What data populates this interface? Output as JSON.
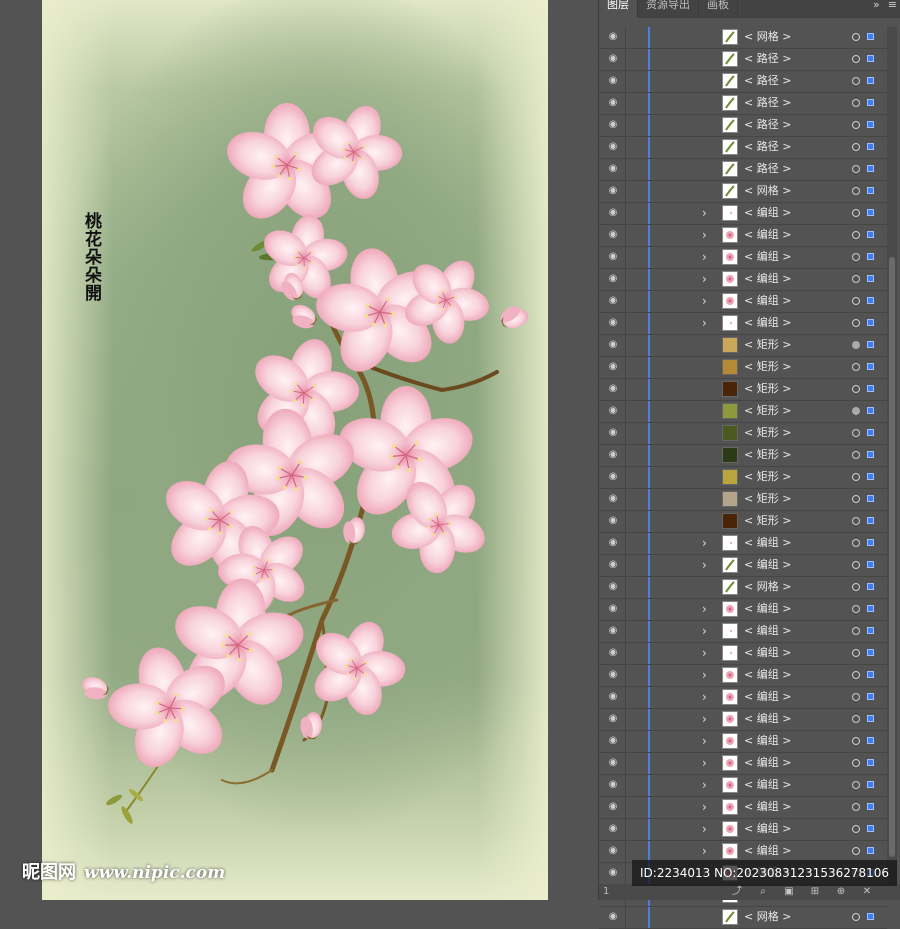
{
  "panel": {
    "tabs": [
      {
        "label": "图层",
        "active": true
      },
      {
        "label": "资源导出",
        "active": false
      },
      {
        "label": "画板",
        "active": false
      }
    ],
    "expand_icon": "double-chevron-right-icon",
    "menu_icon": "hamburger-menu-icon",
    "layers": [
      {
        "label": "< 网格 >",
        "expandable": false,
        "thumb": "leaf"
      },
      {
        "label": "< 路径 >",
        "expandable": false,
        "thumb": "leaf"
      },
      {
        "label": "< 路径 >",
        "expandable": false,
        "thumb": "leaf"
      },
      {
        "label": "< 路径 >",
        "expandable": false,
        "thumb": "leaf"
      },
      {
        "label": "< 路径 >",
        "expandable": false,
        "thumb": "leaf"
      },
      {
        "label": "< 路径 >",
        "expandable": false,
        "thumb": "leaf"
      },
      {
        "label": "< 路径 >",
        "expandable": false,
        "thumb": "leaf"
      },
      {
        "label": "< 网格 >",
        "expandable": false,
        "thumb": "leaf"
      },
      {
        "label": "< 编组 >",
        "expandable": true,
        "thumb": "blank"
      },
      {
        "label": "< 编组 >",
        "expandable": true,
        "thumb": "flower"
      },
      {
        "label": "< 编组 >",
        "expandable": true,
        "thumb": "flower"
      },
      {
        "label": "< 编组 >",
        "expandable": true,
        "thumb": "flower"
      },
      {
        "label": "< 编组 >",
        "expandable": true,
        "thumb": "flower"
      },
      {
        "label": "< 编组 >",
        "expandable": true,
        "thumb": "blank"
      },
      {
        "label": "< 矩形 >",
        "expandable": false,
        "thumb": "swatch",
        "color": "#c9a85a",
        "target_filled": true
      },
      {
        "label": "< 矩形 >",
        "expandable": false,
        "thumb": "swatch",
        "color": "#b48a35"
      },
      {
        "label": "< 矩形 >",
        "expandable": false,
        "thumb": "swatch",
        "color": "#4a2409"
      },
      {
        "label": "< 矩形 >",
        "expandable": false,
        "thumb": "swatch",
        "color": "#8d9a3c",
        "target_filled": true
      },
      {
        "label": "< 矩形 >",
        "expandable": false,
        "thumb": "swatch",
        "color": "#4b5a1f"
      },
      {
        "label": "< 矩形 >",
        "expandable": false,
        "thumb": "swatch",
        "color": "#2c3b15"
      },
      {
        "label": "< 矩形 >",
        "expandable": false,
        "thumb": "swatch",
        "color": "#b9a53e"
      },
      {
        "label": "< 矩形 >",
        "expandable": false,
        "thumb": "swatch",
        "color": "#b3a48a"
      },
      {
        "label": "< 矩形 >",
        "expandable": false,
        "thumb": "swatch",
        "color": "#4b2308"
      },
      {
        "label": "< 编组 >",
        "expandable": true,
        "thumb": "blank"
      },
      {
        "label": "< 编组 >",
        "expandable": true,
        "thumb": "leaf"
      },
      {
        "label": "< 网格 >",
        "expandable": false,
        "thumb": "leaf"
      },
      {
        "label": "< 编组 >",
        "expandable": true,
        "thumb": "flower"
      },
      {
        "label": "< 编组 >",
        "expandable": true,
        "thumb": "blank"
      },
      {
        "label": "< 编组 >",
        "expandable": true,
        "thumb": "blank"
      },
      {
        "label": "< 编组 >",
        "expandable": true,
        "thumb": "flower"
      },
      {
        "label": "< 编组 >",
        "expandable": true,
        "thumb": "flower"
      },
      {
        "label": "< 编组 >",
        "expandable": true,
        "thumb": "flower"
      },
      {
        "label": "< 编组 >",
        "expandable": true,
        "thumb": "flower"
      },
      {
        "label": "< 编组 >",
        "expandable": true,
        "thumb": "flower"
      },
      {
        "label": "< 编组 >",
        "expandable": true,
        "thumb": "flower"
      },
      {
        "label": "< 编组 >",
        "expandable": true,
        "thumb": "flower"
      },
      {
        "label": "< 编组 >",
        "expandable": true,
        "thumb": "flower"
      },
      {
        "label": "< 编组 >",
        "expandable": true,
        "thumb": "flower"
      },
      {
        "label": "< 编组 >",
        "expandable": true,
        "thumb": "flower"
      },
      {
        "label": "< 编组 >",
        "expandable": true,
        "thumb": "flower"
      },
      {
        "label": "< 网格 >",
        "expandable": false,
        "thumb": "leaf"
      }
    ],
    "footer": {
      "layer_count": "1",
      "icons": [
        "export-icon",
        "search-icon",
        "clipping-mask-icon",
        "sublayer-icon",
        "new-layer-icon",
        "trash-icon"
      ]
    }
  },
  "artwork": {
    "poem": "桃花朵朵開",
    "colors": {
      "petal": "#f4c6d0",
      "petal_dark": "#e58fa7",
      "branch": "#6b4a1f"
    }
  },
  "watermark": {
    "logo": "昵图网",
    "site": "www.nipic.com",
    "id_text": "ID:2234013 NO:20230831231536278106"
  }
}
